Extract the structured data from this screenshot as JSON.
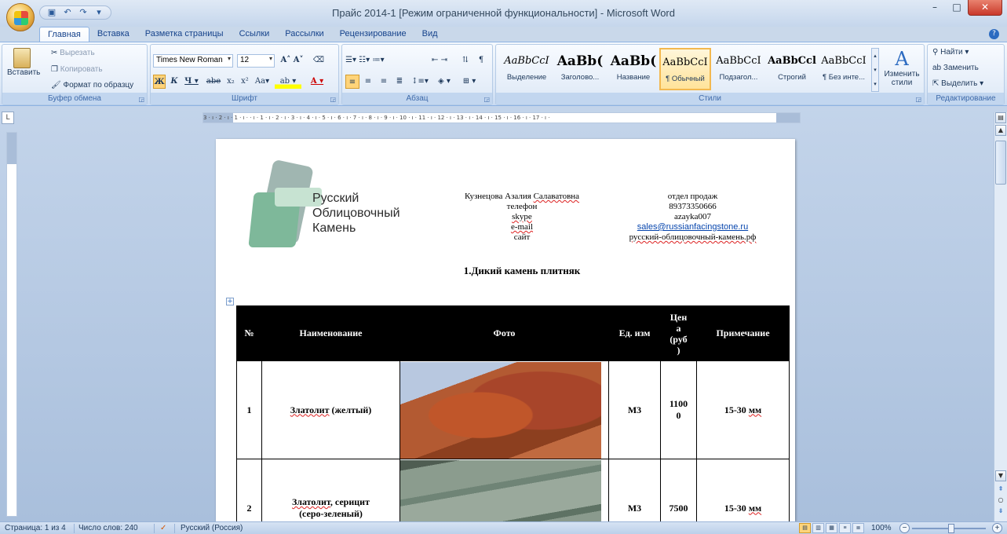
{
  "window": {
    "title": "Прайс 2014-1 [Режим ограниченной функциональности] - Microsoft Word",
    "minimize": "–",
    "maximize": "□",
    "close": "✕"
  },
  "tabs": [
    "Главная",
    "Вставка",
    "Разметка страницы",
    "Ссылки",
    "Рассылки",
    "Рецензирование",
    "Вид"
  ],
  "ribbon": {
    "clipboard": {
      "paste": "Вставить",
      "cut": "Вырезать",
      "copy": "Копировать",
      "format_painter": "Формат по образцу",
      "label": "Буфер обмена"
    },
    "font": {
      "font_name": "Times New Roman",
      "font_size": "12",
      "label": "Шрифт"
    },
    "paragraph": {
      "label": "Абзац"
    },
    "styles": {
      "label": "Стили",
      "items": [
        {
          "sample": "AaBbCcI",
          "name": "Выделение"
        },
        {
          "sample": "AaBb(",
          "name": "Заголово..."
        },
        {
          "sample": "AaBb(",
          "name": "Название"
        },
        {
          "sample": "AaBbCcI",
          "name": "¶ Обычный"
        },
        {
          "sample": "AaBbCcI",
          "name": "Подзагол..."
        },
        {
          "sample": "AaBbCcl",
          "name": "Строгий"
        },
        {
          "sample": "AaBbCcI",
          "name": "¶ Без инте..."
        }
      ],
      "change_styles": "Изменить стили"
    },
    "editing": {
      "find": "Найти",
      "replace": "Заменить",
      "select": "Выделить",
      "label": "Редактирование"
    }
  },
  "ruler": {
    "text": "3 · ı · 2 · ı · 1 · ı ·   · ı · 1 · ı · 2 · ı · 3 · ı · 4 · ı · 5 · ı · 6 · ı · 7 · ı · 8 · ı · 9 · ı · 10 · ı · 11 · ı · 12 · ı · 13 · ı · 14 · ı · 15 · ı · 16 · ı · 17 · ı ·"
  },
  "document": {
    "logo_text": [
      "Русский",
      "Облицовочный",
      "Камень"
    ],
    "contact_left": [
      "Кузнецова Азалия Салаватовна",
      "телефон",
      "skype",
      "e-mail",
      "сайт"
    ],
    "contact_right": [
      "отдел продаж",
      "89373350666",
      "azayka007",
      "sales@russianfacingstone.ru",
      "русский-облицовочный-камень.рф"
    ],
    "section_title": "1.Дикий камень плитняк",
    "table": {
      "headers": [
        "№",
        "Наименование",
        "Фото",
        "Ед. изм",
        "Цен а (руб )",
        "Примечание"
      ],
      "rows": [
        {
          "num": "1",
          "name": "Златолит (желтый)",
          "unit": "М3",
          "price": "11000",
          "note": "15-30 мм"
        },
        {
          "num": "2",
          "name": "Златолит, серицит (серо-зеленый)",
          "unit": "М3",
          "price": "7500",
          "note": "15-30 мм"
        }
      ]
    }
  },
  "status": {
    "page": "Страница: 1 из 4",
    "words": "Число слов: 240",
    "language": "Русский (Россия)",
    "zoom": "100%"
  }
}
